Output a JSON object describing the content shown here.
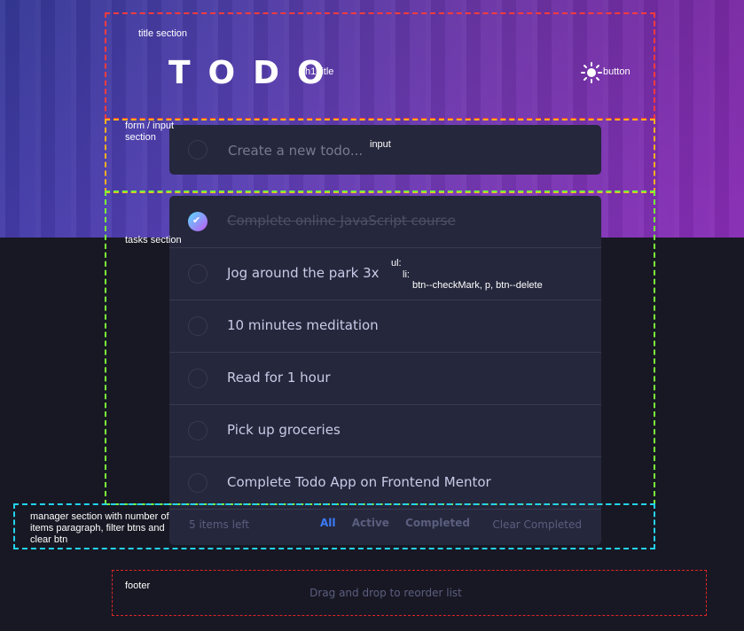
{
  "header": {
    "title": "TODO",
    "theme_toggle_icon": "sun-icon"
  },
  "form": {
    "placeholder": "Create a new todo..."
  },
  "todos": [
    {
      "text": "Complete online JavaScript course",
      "completed": true
    },
    {
      "text": "Jog around the park 3x",
      "completed": false
    },
    {
      "text": "10 minutes meditation",
      "completed": false
    },
    {
      "text": "Read for 1 hour",
      "completed": false
    },
    {
      "text": "Pick up groceries",
      "completed": false
    },
    {
      "text": "Complete Todo App on Frontend Mentor",
      "completed": false
    }
  ],
  "manager": {
    "items_left": "5 items left",
    "filters": [
      "All",
      "Active",
      "Completed"
    ],
    "active_filter": "All",
    "clear_label": "Clear Completed"
  },
  "footer": {
    "hint": "Drag and drop to reorder list"
  },
  "annotations": {
    "title_section": "title section",
    "h1_title": "h1 title",
    "button": "button",
    "form_section": "form / input section",
    "input": "input",
    "tasks_section": "tasks section",
    "ul": "ul:",
    "li": "li:",
    "li_parts": "btn--checkMark, p,  btn--delete",
    "manager_section": "manager section with number of items paragraph, filter btns and clear btn",
    "footer": "footer"
  },
  "colors": {
    "accent": "#3a7cfd",
    "card": "#25273c",
    "background": "#181824",
    "check_gradient_start": "#57ddff",
    "check_gradient_end": "#c058f3"
  }
}
